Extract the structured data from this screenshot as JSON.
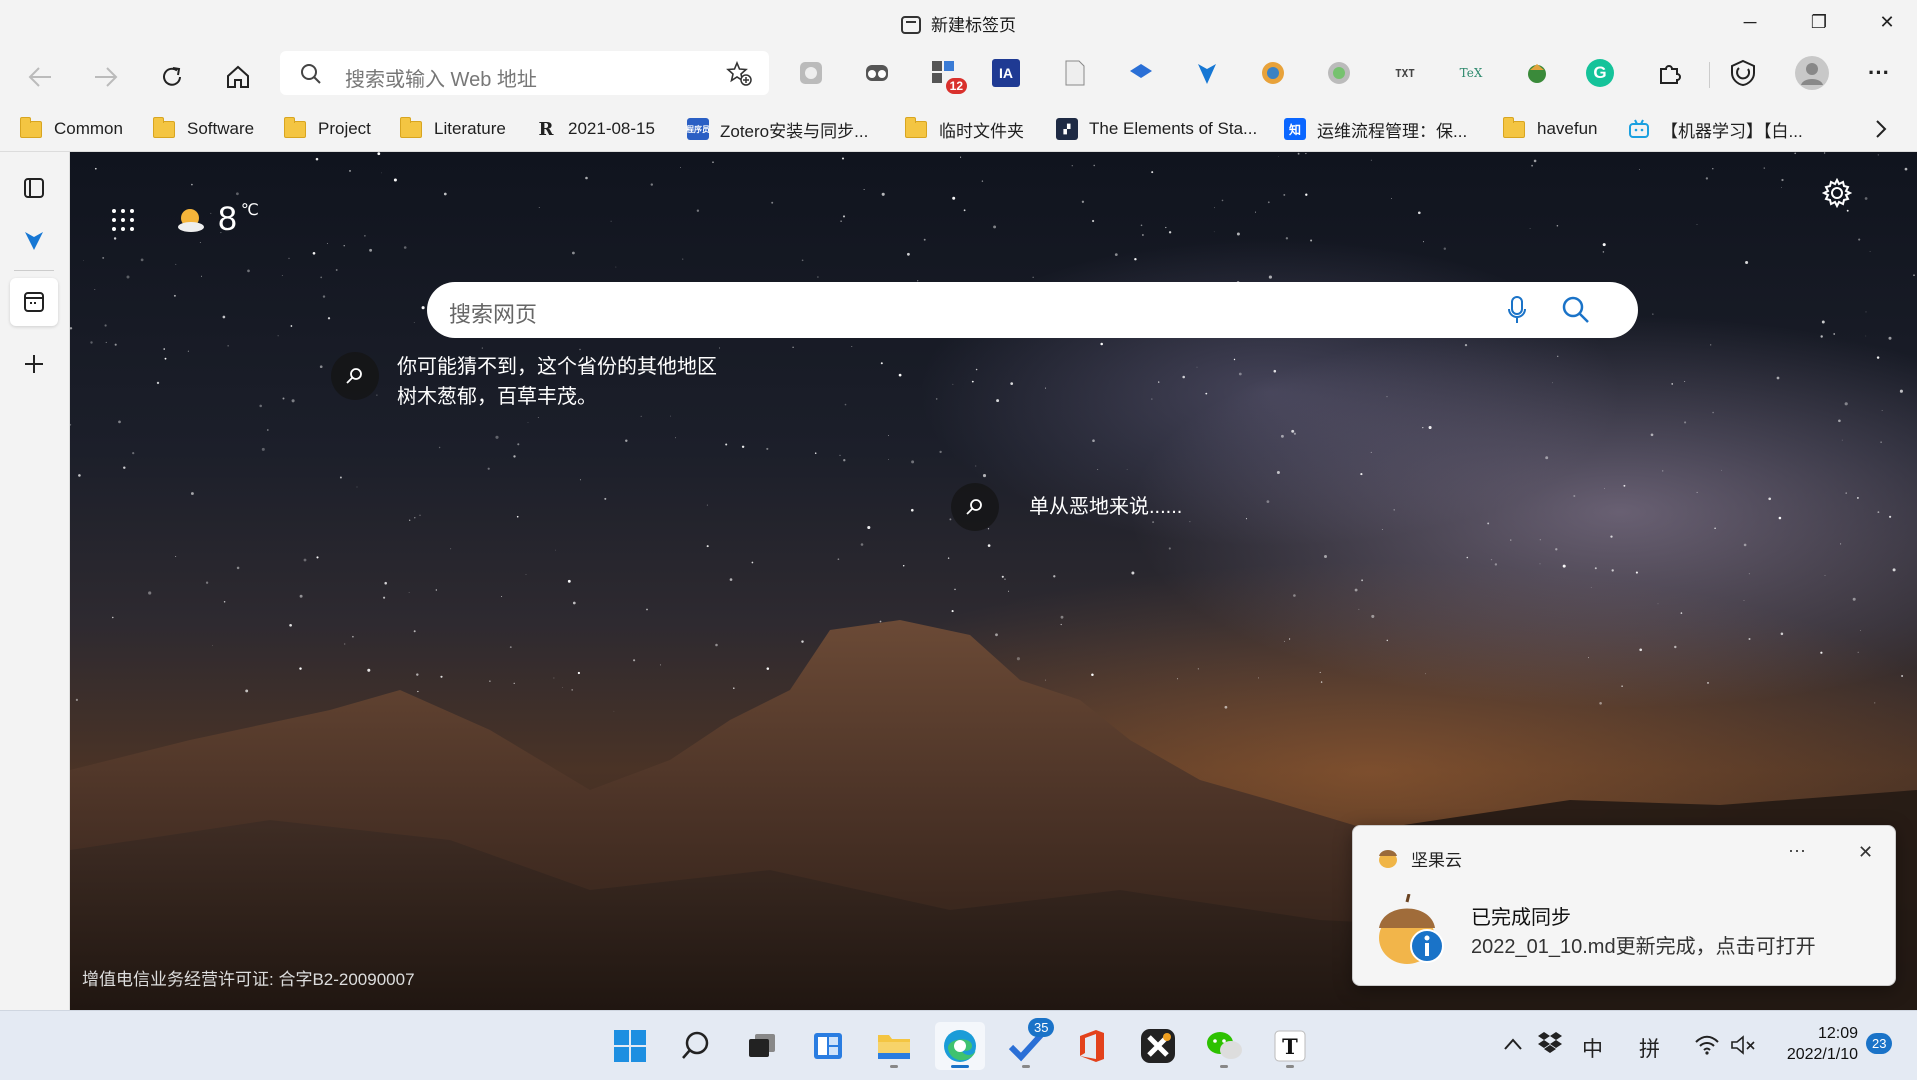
{
  "window": {
    "title": "新建标签页",
    "minimize": "─",
    "restore": "❐",
    "close": "✕"
  },
  "toolbar": {
    "address_placeholder": "搜索或输入 Web 地址",
    "ext_badge": "12",
    "ext_ia_label": "IA",
    "ext_txt_label": "TXT",
    "ext_tex_label": "TeX",
    "ext_g_label": "G"
  },
  "bookmarks": [
    {
      "label": "Common"
    },
    {
      "label": "Software"
    },
    {
      "label": "Project"
    },
    {
      "label": "Literature"
    },
    {
      "label": "2021-08-15"
    },
    {
      "label": "Zotero安装与同步..."
    },
    {
      "label": "临时文件夹"
    },
    {
      "label": "The Elements of Sta..."
    },
    {
      "label": "运维流程管理：保..."
    },
    {
      "label": "havefun"
    },
    {
      "label": "【机器学习】【白..."
    }
  ],
  "bookmark_favicon_text": {
    "zhihu": "知",
    "zotero": "程序员"
  },
  "newtab": {
    "temperature": "8",
    "temp_unit": "℃",
    "search_placeholder": "搜索网页",
    "hotspot1": "你可能猜不到，这个省份的其他地区树木葱郁，百草丰茂。",
    "hotspot2": "单从恶地来说......",
    "license": "增值电信业务经营许可证: 合字B2-20090007"
  },
  "toast": {
    "app": "坚果云",
    "more": "···",
    "close": "✕",
    "title": "已完成同步",
    "body": "2022_01_10.md更新完成，点击可打开"
  },
  "taskbar": {
    "todo_badge": "35",
    "ime_lang": "中",
    "ime_mode": "拼",
    "time": "12:09",
    "date": "2022/1/10",
    "notif_count": "23"
  }
}
